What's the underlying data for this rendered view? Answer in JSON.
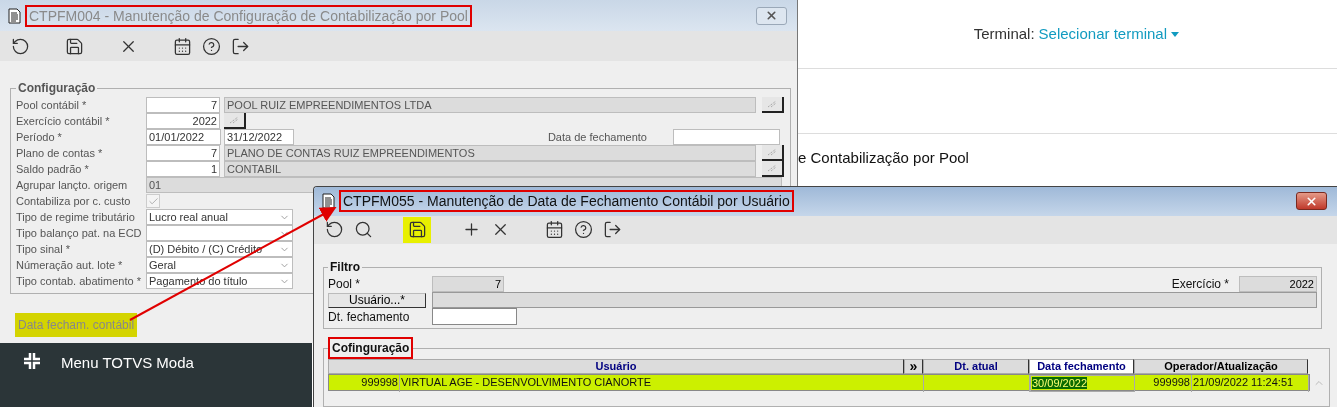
{
  "page": {
    "terminal_label": "Terminal:",
    "terminal_value": "Selecionar terminal",
    "heading": "e Contabilização por Pool",
    "sidebar_title": "Menu TOTVS Moda"
  },
  "main_window": {
    "title": "CTPFM004 - Manutenção de Configuração de Contabilização por Pool",
    "title_annotated": true,
    "active": false,
    "toolbar": [
      [
        {
          "kind": "undo",
          "annotated": false
        }
      ],
      [
        {
          "kind": "save",
          "annotated": false
        }
      ],
      [
        {
          "kind": "close",
          "annotated": false
        }
      ],
      [
        {
          "kind": "calendar",
          "annotated": false
        },
        {
          "kind": "help",
          "annotated": false
        },
        {
          "kind": "exit",
          "annotated": false
        }
      ]
    ],
    "group_title": "Configuração",
    "fields": [
      {
        "kind": "lookup",
        "label": "Pool contábil *",
        "code": "7",
        "description": "POOL RUIZ EMPREENDIMENTOS LTDA"
      },
      {
        "kind": "code_button",
        "label": "Exercício contábil *",
        "code": "2022"
      },
      {
        "kind": "period",
        "label": "Período *",
        "start": "01/01/2022",
        "end": "31/12/2022",
        "side_label": "Data de fechamento"
      },
      {
        "kind": "lookup",
        "label": "Plano de contas *",
        "code": "7",
        "description": "PLANO DE CONTAS RUIZ EMPREENDIMENTOS"
      },
      {
        "kind": "lookup",
        "label": "Saldo padrão *",
        "code": "1",
        "description": "CONTABIL"
      },
      {
        "kind": "text",
        "label": "Agrupar lançto. origem",
        "value": "01"
      },
      {
        "kind": "checkbox",
        "label": "Contabiliza por c. custo",
        "checked": true
      },
      {
        "kind": "select",
        "label": "Tipo de regime tributário",
        "value": "Lucro real anual"
      },
      {
        "kind": "select",
        "label": "Tipo balanço pat. na ECD"
      },
      {
        "kind": "select",
        "label": "Tipo sinal *",
        "value": "(D) Débito / (C) Crédito"
      },
      {
        "kind": "select",
        "label": "Númeração aut. lote *",
        "value": "Geral"
      },
      {
        "kind": "select",
        "label": "Tipo contab. abatimento *",
        "value": "Pagamento do título"
      }
    ],
    "link": "Data fecham. contábil",
    "link_annotated": true
  },
  "dialog": {
    "title": "CTPFM055 - Manutenção de Data de Fechamento Contábil por Usuário",
    "title_annotated": true,
    "active": true,
    "toolbar": [
      [
        {
          "kind": "undo",
          "annotated": false
        },
        {
          "kind": "search",
          "annotated": false
        }
      ],
      [
        {
          "kind": "save",
          "annotated": true
        }
      ],
      [
        {
          "kind": "add",
          "annotated": false
        },
        {
          "kind": "close",
          "annotated": false
        }
      ],
      [
        {
          "kind": "calendar",
          "annotated": false
        },
        {
          "kind": "help",
          "annotated": false
        },
        {
          "kind": "exit",
          "annotated": false
        }
      ]
    ],
    "filter": {
      "title": "Filtro",
      "pool_label": "Pool *",
      "pool_value": "7",
      "exercise_label": "Exercício *",
      "exercise_value": "2022",
      "user_button": "Usuário...*",
      "date_label": "Dt. fechamento"
    },
    "grid_title": "Cofinguração",
    "grid_title_annotated": true,
    "columns": [
      {
        "label": "Usuário",
        "color": "#000080",
        "focused": false
      },
      {
        "label": "»",
        "color": "#000000",
        "focused": false
      },
      {
        "label": "Dt. atual",
        "color": "#000080",
        "focused": false
      },
      {
        "label": "Data fechamento",
        "color": "#000080",
        "focused": true
      },
      {
        "label": "Operador/Atualização",
        "color": "#000000",
        "focused": false
      }
    ],
    "rows": [
      {
        "selected": true,
        "cells": [
          {
            "code": "999998",
            "name": "VIRTUAL AGE - DESENVOLVIMENTO CIANORTE",
            "focused": false
          },
          {
            "text": "",
            "focused": false
          },
          {
            "text": "",
            "focused": false
          },
          {
            "text": "30/09/2022",
            "focused": true
          },
          {
            "code": "999998",
            "name": "21/09/2022 11:24:51",
            "focused": false
          }
        ]
      }
    ]
  }
}
